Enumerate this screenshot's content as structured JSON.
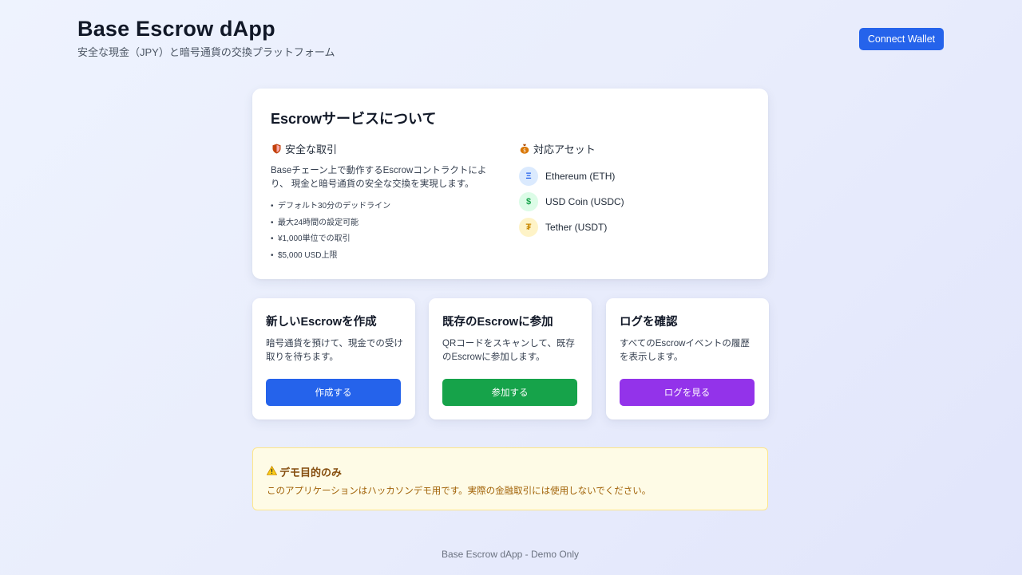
{
  "header": {
    "title": "Base Escrow dApp",
    "subtitle": "安全な現金（JPY）と暗号通貨の交換プラットフォーム",
    "connect_label": "Connect Wallet"
  },
  "about": {
    "title": "Escrowサービスについて",
    "security_heading": "安全な取引",
    "security_icon": "shield-icon",
    "description": "Baseチェーン上で動作するEscrowコントラクトにより、 現金と暗号通貨の安全な交換を実現します。",
    "features": [
      "デフォルト30分のデッドライン",
      "最大24時間の設定可能",
      "¥1,000単位での取引",
      "$5,000 USD上限"
    ],
    "assets_heading": "対応アセット",
    "assets_icon": "money-bag-icon",
    "assets": [
      {
        "label": "Ethereum (ETH)",
        "symbol": "Ξ",
        "icon": "ethereum-icon",
        "bg": "#dbeafe",
        "fg": "#2563eb"
      },
      {
        "label": "USD Coin (USDC)",
        "symbol": "$",
        "icon": "usdc-icon",
        "bg": "#dcfce7",
        "fg": "#16a34a"
      },
      {
        "label": "Tether (USDT)",
        "symbol": "₮",
        "icon": "tether-icon",
        "bg": "#fef3c7",
        "fg": "#ca8a04"
      }
    ]
  },
  "actions": [
    {
      "title": "新しいEscrowを作成",
      "description": "暗号通貨を預けて、現金での受け取りを待ちます。",
      "button": "作成する",
      "color": "#2563eb"
    },
    {
      "title": "既存のEscrowに参加",
      "description": "QRコードをスキャンして、既存のEscrowに参加します。",
      "button": "参加する",
      "color": "#16a34a"
    },
    {
      "title": "ログを確認",
      "description": "すべてのEscrowイベントの履歴を表示します。",
      "button": "ログを見る",
      "color": "#9333ea"
    }
  ],
  "notice": {
    "title": "デモ目的のみ",
    "icon": "warning-icon",
    "text": "このアプリケーションはハッカソンデモ用です。実際の金融取引には使用しないでください。"
  },
  "footer": {
    "text": "Base Escrow dApp - Demo Only"
  }
}
